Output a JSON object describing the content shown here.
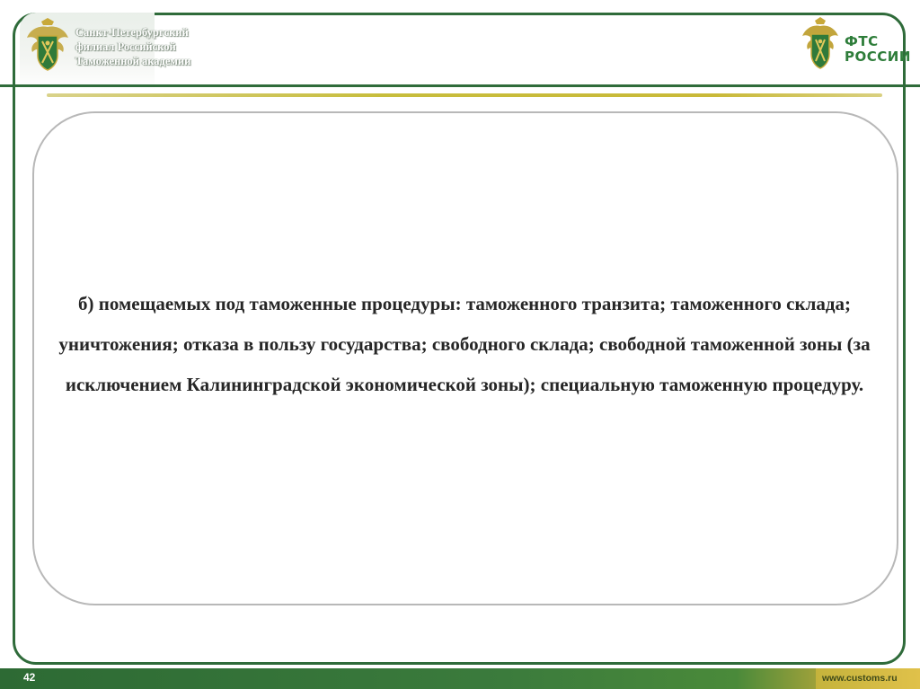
{
  "header": {
    "academy_title": "Санкт-Петербургский\nфилиал Российской\nТаможенной академии",
    "fts_line1": "ФТС",
    "fts_line2": "РОССИИ"
  },
  "slide": {
    "body_text": "б) помещаемых под таможенные процедуры:  таможенного транзита; таможенного склада; уничтожения; отказа в пользу государства; свободного склада; свободной таможенной зоны (за исключением Калининградской экономической зоны); специальную таможенную процедуру."
  },
  "footer": {
    "slide_number": "42",
    "website": "www.customs.ru"
  },
  "icons": {
    "left_emblem": "customs-emblem-icon",
    "right_emblem": "fts-emblem-icon"
  },
  "colors": {
    "frame_green": "#2f6b3a",
    "gold": "#c7bd3c",
    "fts_green": "#2e7d3a",
    "text": "#262626"
  }
}
